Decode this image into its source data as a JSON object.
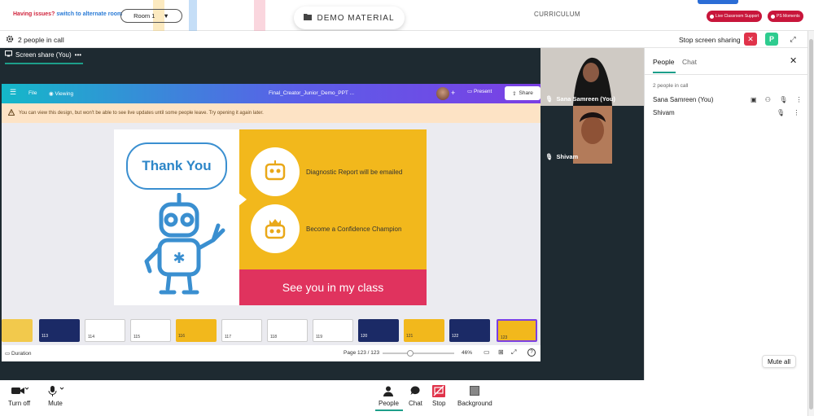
{
  "topbar": {
    "issues_label": "Having issues?",
    "switch_label": "switch to alternate room",
    "room_label": "Room 1",
    "demo_label": "DEMO MATERIAL",
    "curriculum_label": "CURRICULUM",
    "live_support_label": "Live Classroom Support",
    "moments_label": "PS Moments"
  },
  "callbar": {
    "people_count": "2 people in call",
    "stop_sharing_label": "Stop screen sharing",
    "p_label": "P"
  },
  "stage": {
    "tab_label": "Screen share (You)",
    "tab_more": "•••",
    "canva": {
      "menu": "File",
      "viewing": "Viewing",
      "doc_title": "Final_Creator_Junior_Demo_PPT ...",
      "present": "Present",
      "share": "Share"
    },
    "warning": "You can view this design, but won't be able to see live updates until some people leave. Try opening it again later.",
    "slide": {
      "heading": "Thank You",
      "line1": "Diagnostic Report will be emailed",
      "line2": "Become a Confidence Champion",
      "footer": "See you in my class"
    },
    "thumbnails": [
      "",
      "113",
      "114",
      "115",
      "116",
      "117",
      "118",
      "119",
      "120",
      "121",
      "122",
      "123"
    ],
    "footer": {
      "duration": "Duration",
      "page": "Page 123 / 123",
      "zoom": "46%",
      "help": "?"
    }
  },
  "videos": [
    {
      "name": "Sana Samreen (You)"
    },
    {
      "name": "Shivam"
    }
  ],
  "panel": {
    "tab_people": "People",
    "tab_chat": "Chat",
    "close": "✕",
    "count": "2 people in call",
    "people": [
      {
        "name": "Sana Samreen (You)"
      },
      {
        "name": "Shivam"
      }
    ],
    "mute_all": "Mute all"
  },
  "toolbar": {
    "turn_off": "Turn off",
    "mute": "Mute",
    "people": "People",
    "chat": "Chat",
    "stop": "Stop",
    "background": "Background"
  },
  "colors": {
    "accent": "#1d9e8a",
    "danger": "#c8163b",
    "slide_yellow": "#f2b81c",
    "slide_pink": "#e0335e"
  }
}
